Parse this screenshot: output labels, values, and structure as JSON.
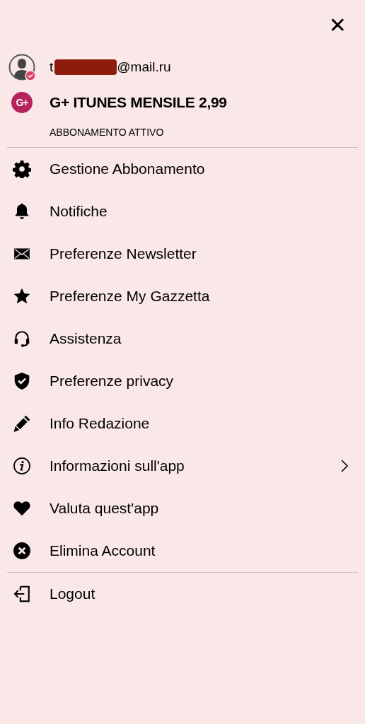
{
  "close_button": {
    "label": "✕"
  },
  "account": {
    "email_start": "t",
    "email_redacted": true,
    "email_end": "@mail.ru",
    "verified": true,
    "plan_badge": "G+",
    "plan": "G+ ITUNES MENSILE 2,99",
    "status": "ABBONAMENTO ATTIVO"
  },
  "menu_groups": [
    {
      "items": [
        {
          "kind": "gear",
          "label": "Gestione Abbonamento",
          "has_submenu": false
        },
        {
          "kind": "bell",
          "label": "Notifiche",
          "has_submenu": false
        },
        {
          "kind": "envelope",
          "label": "Preferenze Newsletter",
          "has_submenu": false
        },
        {
          "kind": "star",
          "label": "Preferenze My Gazzetta",
          "has_submenu": false
        },
        {
          "kind": "headset",
          "label": "Assistenza",
          "has_submenu": false
        },
        {
          "kind": "shield",
          "label": "Preferenze privacy",
          "has_submenu": false
        },
        {
          "kind": "pen",
          "label": "Info Redazione",
          "has_submenu": false
        },
        {
          "kind": "info",
          "label": "Informazioni sull'app",
          "has_submenu": true
        },
        {
          "kind": "heart",
          "label": "Valuta quest'app",
          "has_submenu": false
        },
        {
          "kind": "remove",
          "label": "Elimina Account",
          "has_submenu": false
        }
      ]
    },
    {
      "items": [
        {
          "kind": "logout",
          "label": "Logout",
          "has_submenu": false
        }
      ]
    }
  ]
}
